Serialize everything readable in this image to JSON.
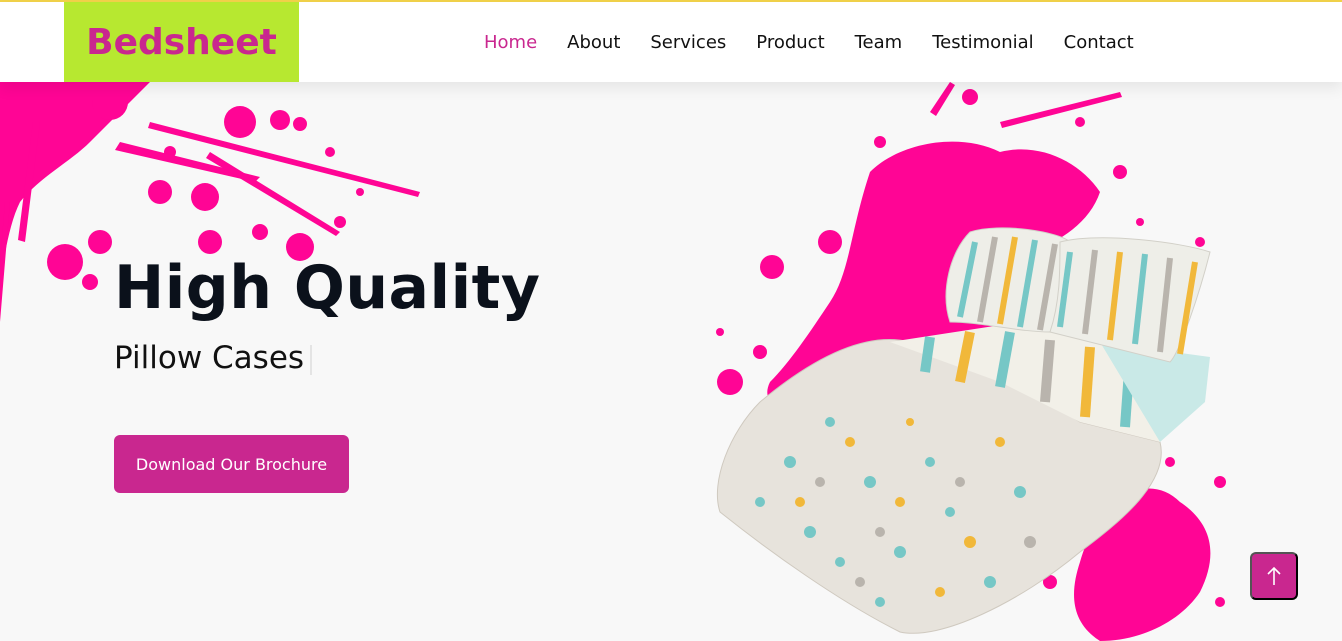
{
  "brand": {
    "name": "Bedsheet"
  },
  "nav": {
    "items": [
      {
        "label": "Home",
        "active": true
      },
      {
        "label": "About",
        "active": false
      },
      {
        "label": "Services",
        "active": false
      },
      {
        "label": "Product",
        "active": false
      },
      {
        "label": "Team",
        "active": false
      },
      {
        "label": "Testimonial",
        "active": false
      },
      {
        "label": "Contact",
        "active": false
      }
    ]
  },
  "hero": {
    "title": "High Quality",
    "subtitle": "Pillow Cases",
    "cta_label": "Download Our Brochure"
  },
  "scroll_top": {
    "icon": "arrow-up-icon"
  },
  "colors": {
    "accent": "#c9278f",
    "logo_bg": "#b7e830",
    "splash": "#ff0595",
    "top_line": "#f2d34a"
  }
}
